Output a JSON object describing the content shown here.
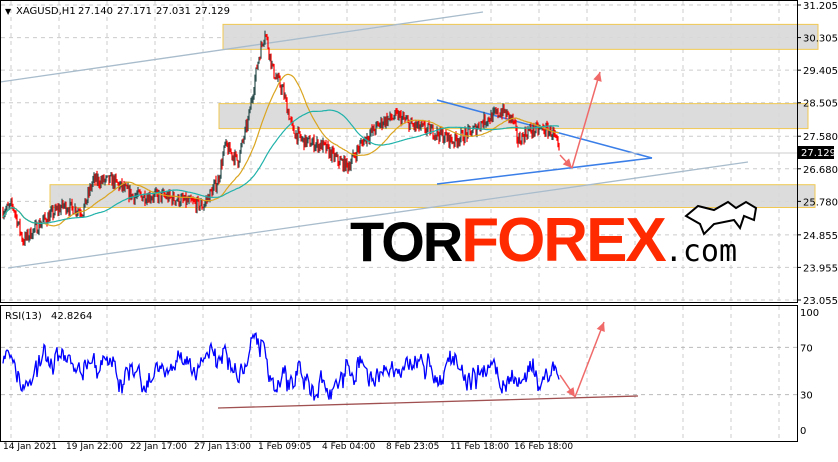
{
  "header": {
    "symbol": "XAGUSD,H1",
    "open": "27.140",
    "high": "27.171",
    "low": "27.031",
    "close": "27.129"
  },
  "logo": {
    "part1": "TOR",
    "part2": "FOREX",
    "part3": ".com"
  },
  "colors": {
    "bull": "#2f4f4f",
    "bear": "#ff0000",
    "ma_fast": "#daa520",
    "ma_slow": "#20b2aa",
    "zone_border": "#f0c850",
    "zone_fill": "#d8d8d8",
    "triangle": "#3a7ee8",
    "channel": "#a8bccc",
    "arrow": "#f06a6a",
    "rsi": "#0000ff",
    "rsi_support": "#a05050"
  },
  "chart_data": [
    {
      "type": "candlestick",
      "title": "XAGUSD,H1",
      "yaxis": {
        "min": 23.055,
        "max": 31.205,
        "ticks": [
          "31.205",
          "30.305",
          "29.405",
          "28.505",
          "27.580",
          "26.680",
          "25.780",
          "24.855",
          "23.955",
          "23.055"
        ]
      },
      "xaxis": {
        "ticks": [
          "14 Jan 2021",
          "19 Jan 22:00",
          "22 Jan 17:00",
          "27 Jan 13:00",
          "1 Feb 09:05",
          "4 Feb 04:00",
          "8 Feb 23:05",
          "11 Feb 18:00",
          "16 Feb 18:00"
        ]
      },
      "current_price": "27.129",
      "approx_close_path": [
        [
          0,
          25.52
        ],
        [
          10,
          25.66
        ],
        [
          20,
          24.69
        ],
        [
          40,
          25.24
        ],
        [
          60,
          25.66
        ],
        [
          80,
          25.52
        ],
        [
          90,
          26.35
        ],
        [
          110,
          26.35
        ],
        [
          130,
          25.93
        ],
        [
          160,
          25.93
        ],
        [
          200,
          25.66
        ],
        [
          215,
          26.35
        ],
        [
          222,
          27.31
        ],
        [
          235,
          26.9
        ],
        [
          245,
          28.0
        ],
        [
          255,
          29.66
        ],
        [
          262,
          30.49
        ],
        [
          270,
          29.38
        ],
        [
          280,
          28.83
        ],
        [
          290,
          27.72
        ],
        [
          300,
          27.45
        ],
        [
          320,
          27.31
        ],
        [
          335,
          26.9
        ],
        [
          345,
          26.76
        ],
        [
          360,
          27.45
        ],
        [
          380,
          28.0
        ],
        [
          395,
          28.14
        ],
        [
          410,
          27.86
        ],
        [
          430,
          27.72
        ],
        [
          450,
          27.45
        ],
        [
          470,
          27.72
        ],
        [
          480,
          28.0
        ],
        [
          500,
          28.28
        ],
        [
          510,
          28.0
        ],
        [
          515,
          27.45
        ],
        [
          525,
          27.72
        ],
        [
          540,
          27.78
        ],
        [
          550,
          27.67
        ],
        [
          556,
          27.13
        ]
      ],
      "zones": [
        [
          29.98,
          30.67
        ],
        [
          27.79,
          28.48
        ],
        [
          25.61,
          26.24
        ]
      ],
      "indicators": [
        "MA fast",
        "MA slow"
      ]
    },
    {
      "type": "line",
      "title": "RSI(13) 42.8264",
      "label": "RSI(13)",
      "value": "42.8264",
      "ylim": [
        0,
        100
      ],
      "yticks": [
        "100",
        "70",
        "30",
        "0"
      ],
      "last": 42.83
    }
  ]
}
